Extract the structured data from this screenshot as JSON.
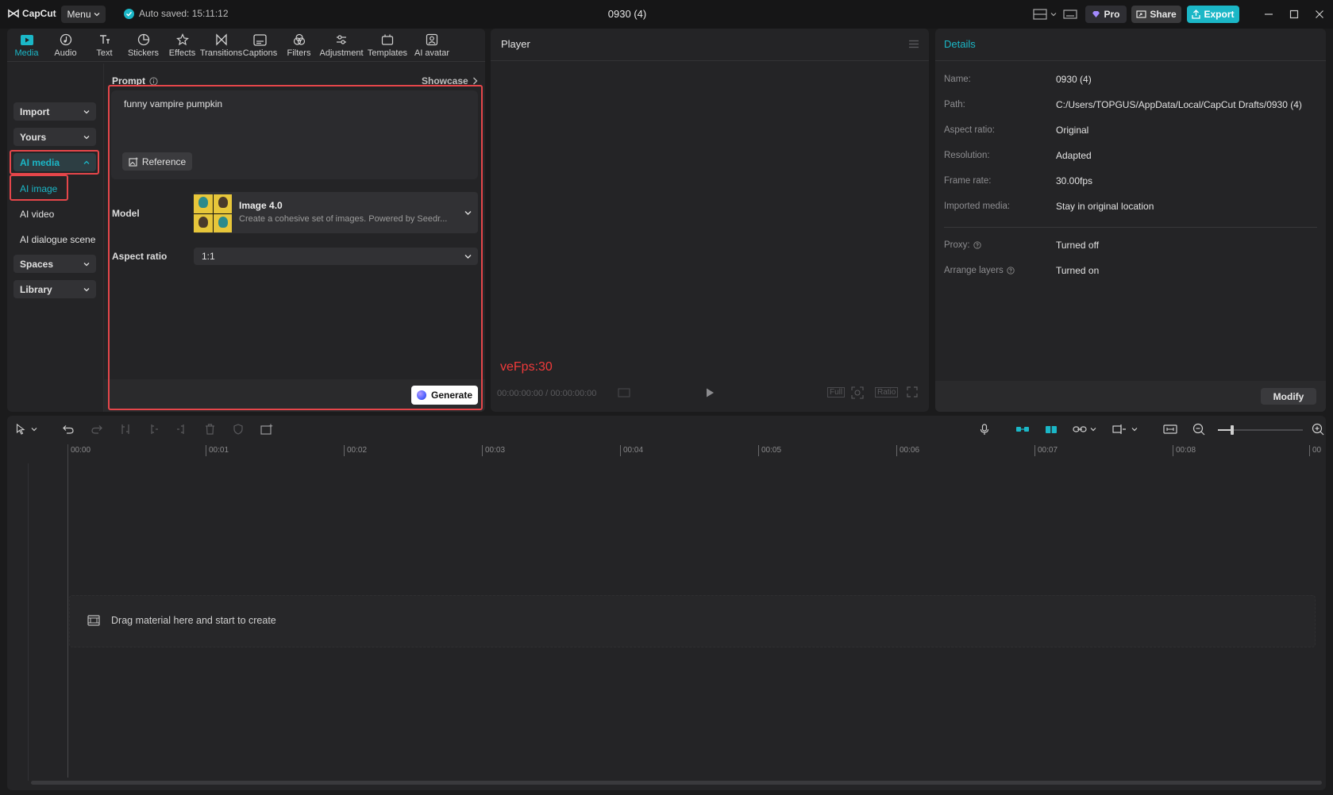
{
  "app": {
    "logo_text": "CapCut",
    "menu_label": "Menu",
    "autosave_text": "Auto saved: 15:11:12",
    "doc_title": "0930 (4)",
    "pro_label": "Pro",
    "share_label": "Share",
    "export_label": "Export",
    "accent": "#1bb7c7"
  },
  "tabs": [
    {
      "label": "Media",
      "icon": "media-icon"
    },
    {
      "label": "Audio",
      "icon": "audio-icon"
    },
    {
      "label": "Text",
      "icon": "text-icon"
    },
    {
      "label": "Stickers",
      "icon": "stickers-icon"
    },
    {
      "label": "Effects",
      "icon": "effects-icon"
    },
    {
      "label": "Transitions",
      "icon": "transitions-icon"
    },
    {
      "label": "Captions",
      "icon": "captions-icon"
    },
    {
      "label": "Filters",
      "icon": "filters-icon"
    },
    {
      "label": "Adjustment",
      "icon": "adjustment-icon"
    },
    {
      "label": "Templates",
      "icon": "templates-icon"
    },
    {
      "label": "AI avatar",
      "icon": "ai-avatar-icon"
    }
  ],
  "sidebar": {
    "import": "Import",
    "yours": "Yours",
    "ai_media": "AI media",
    "ai_image": "AI image",
    "ai_video": "AI video",
    "ai_dialogue": "AI dialogue scene",
    "spaces": "Spaces",
    "library": "Library"
  },
  "prompt": {
    "label": "Prompt",
    "showcase": "Showcase",
    "value": "funny vampire pumpkin",
    "reference_label": "Reference",
    "model_label": "Model",
    "model_name": "Image 4.0",
    "model_desc": "Create a cohesive set of images. Powered by Seedr...",
    "aspect_label": "Aspect ratio",
    "aspect_value": "1:1",
    "generate_label": "Generate"
  },
  "player": {
    "title": "Player",
    "fps_overlay": "veFps:30",
    "timecode": "00:00:00:00 / 00:00:00:00",
    "full_label": "Full",
    "ratio_label": "Ratio"
  },
  "details": {
    "title": "Details",
    "rows": [
      {
        "key": "Name:",
        "value": "0930 (4)"
      },
      {
        "key": "Path:",
        "value": "C:/Users/TOPGUS/AppData/Local/CapCut Drafts/0930 (4)"
      },
      {
        "key": "Aspect ratio:",
        "value": "Original"
      },
      {
        "key": "Resolution:",
        "value": "Adapted"
      },
      {
        "key": "Frame rate:",
        "value": "30.00fps"
      },
      {
        "key": "Imported media:",
        "value": "Stay in original location"
      }
    ],
    "proxy_key": "Proxy:",
    "proxy_value": "Turned off",
    "arrange_key": "Arrange layers",
    "arrange_value": "Turned on",
    "modify_label": "Modify"
  },
  "timeline": {
    "ticks": [
      "00:00",
      "00:01",
      "00:02",
      "00:03",
      "00:04",
      "00:05",
      "00:06",
      "00:07",
      "00:08",
      "00"
    ],
    "drop_text": "Drag material here and start to create"
  }
}
